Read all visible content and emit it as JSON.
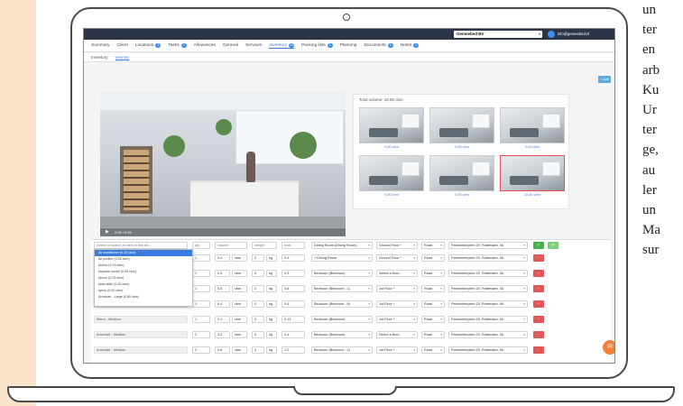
{
  "app": {
    "company": "Gemeebed BV",
    "user_email": "info@gemeebed.nl",
    "nav_tabs": [
      {
        "label": "Summary",
        "badge": ""
      },
      {
        "label": "Client",
        "badge": ""
      },
      {
        "label": "Locations",
        "badge": "2"
      },
      {
        "label": "Tasks",
        "badge": "2"
      },
      {
        "label": "Allowances",
        "badge": ""
      },
      {
        "label": "General",
        "badge": ""
      },
      {
        "label": "Services",
        "badge": ""
      },
      {
        "label": "Inventory",
        "badge": "23"
      },
      {
        "label": "Packing lists",
        "badge": "1"
      },
      {
        "label": "Planning",
        "badge": ""
      },
      {
        "label": "Documents",
        "badge": "1"
      },
      {
        "label": "Notes",
        "badge": "1"
      }
    ],
    "sub_tabs": [
      "Inventory",
      "Verimer"
    ],
    "add_button": "+ Add"
  },
  "video": {
    "time": "0:00 / 0:20",
    "progress": 0.0
  },
  "thumbnails": {
    "total_volume": "Total volume: 19.80 cbm",
    "items": [
      {
        "label": "0.00 cbm"
      },
      {
        "label": "0.00 cbm"
      },
      {
        "label": "0.00 cbm"
      },
      {
        "label": "0.00 cbm"
      },
      {
        "label": "0.00 cbm"
      },
      {
        "label": "19.80 cbm"
      }
    ]
  },
  "table": {
    "search_placeholder": "Select or search an item in this list...",
    "header": {
      "qty": "qty",
      "volume": "volume",
      "weight": "weight",
      "total": "total",
      "room": "Dining Room (Dining Room)",
      "floor": "Ground Floor *",
      "road": "Road",
      "address": "Parmentierplein 20, Rotterdam, NL"
    },
    "dropdown_items": [
      "Air conditioner (0.15 cbm)",
      "Air purifier (0.05 cbm)",
      "Airbed (0.15 cbm)",
      "Airplane model (0.05 cbm)",
      "Aircon (0.20 cbm)",
      "Altar table (0.25 cbm)",
      "apron (0.00 cbm)",
      "Armchair - Large (0.80 cbm)"
    ],
    "rows": [
      {
        "item": "",
        "qty": "1",
        "vol": "0.4",
        "unit": "cbm",
        "weight": "0",
        "wunit": "kg",
        "total": "0.4",
        "room": "+ Dining Room",
        "floor": "Ground Floor *",
        "road": "Road",
        "address": "Parmentierplein 20, Rotterdam, NL"
      },
      {
        "item": "",
        "qty": "1",
        "vol": "0.3",
        "unit": "cbm",
        "weight": "0",
        "wunit": "kg",
        "total": "0.3",
        "room": "Bedroom (Bedroom)",
        "floor": "Select a floor...",
        "road": "Road",
        "address": "Parmentierplein 20, Rotterdam, NL"
      },
      {
        "item": "",
        "qty": "1",
        "vol": "0.5",
        "unit": "cbm",
        "weight": "0",
        "wunit": "kg",
        "total": "0.5",
        "room": "Bedroom (Bedroom - 1)",
        "floor": "1st Floor *",
        "road": "Road",
        "address": "Parmentierplein 20, Rotterdam, NL"
      },
      {
        "item": "",
        "qty": "1",
        "vol": "0.4",
        "unit": "cbm",
        "weight": "0",
        "wunit": "kg",
        "total": "0.4",
        "room": "Bedroom (Bedroom - 8)",
        "floor": "1st Floor *",
        "road": "Road",
        "address": "Parmentierplein 20, Rotterdam, NL"
      },
      {
        "item": "Mirror - Medium",
        "qty": "1",
        "vol": "0.1",
        "unit": "cbm",
        "weight": "0",
        "wunit": "kg",
        "total": "0.13",
        "room": "Bedroom (Bedroom)",
        "floor": "1st Floor *",
        "road": "Road",
        "address": "Parmentierplein 20, Rotterdam, NL"
      },
      {
        "item": "Armchair - Medium",
        "qty": "2",
        "vol": "1.2",
        "unit": "cbm",
        "weight": "0",
        "wunit": "kg",
        "total": "2.4",
        "room": "Bedroom (Bedroom)",
        "floor": "Select a floor...",
        "road": "Road",
        "address": "Parmentierplein 20, Rotterdam, NL"
      },
      {
        "item": "Armchair - Medium",
        "qty": "2",
        "vol": "0.6",
        "unit": "cbm",
        "weight": "0",
        "wunit": "kg",
        "total": "1.2",
        "room": "Bedroom (Bedroom - 2)",
        "floor": "1st Floor *",
        "road": "Road",
        "address": "Parmentierplein 20, Rotterdam, NL"
      }
    ]
  },
  "side_text": [
    "un",
    "ter",
    "en",
    "arb",
    "Ku",
    "Ur",
    "ter",
    "ge,",
    "au",
    "ler",
    "un",
    "Ma",
    "sur"
  ],
  "colors": {
    "accent": "#3b7ddd",
    "delete": "#e05757",
    "confirm": "#4caf50",
    "chat": "#f0803c",
    "page_strip": "#fbe3cc"
  }
}
